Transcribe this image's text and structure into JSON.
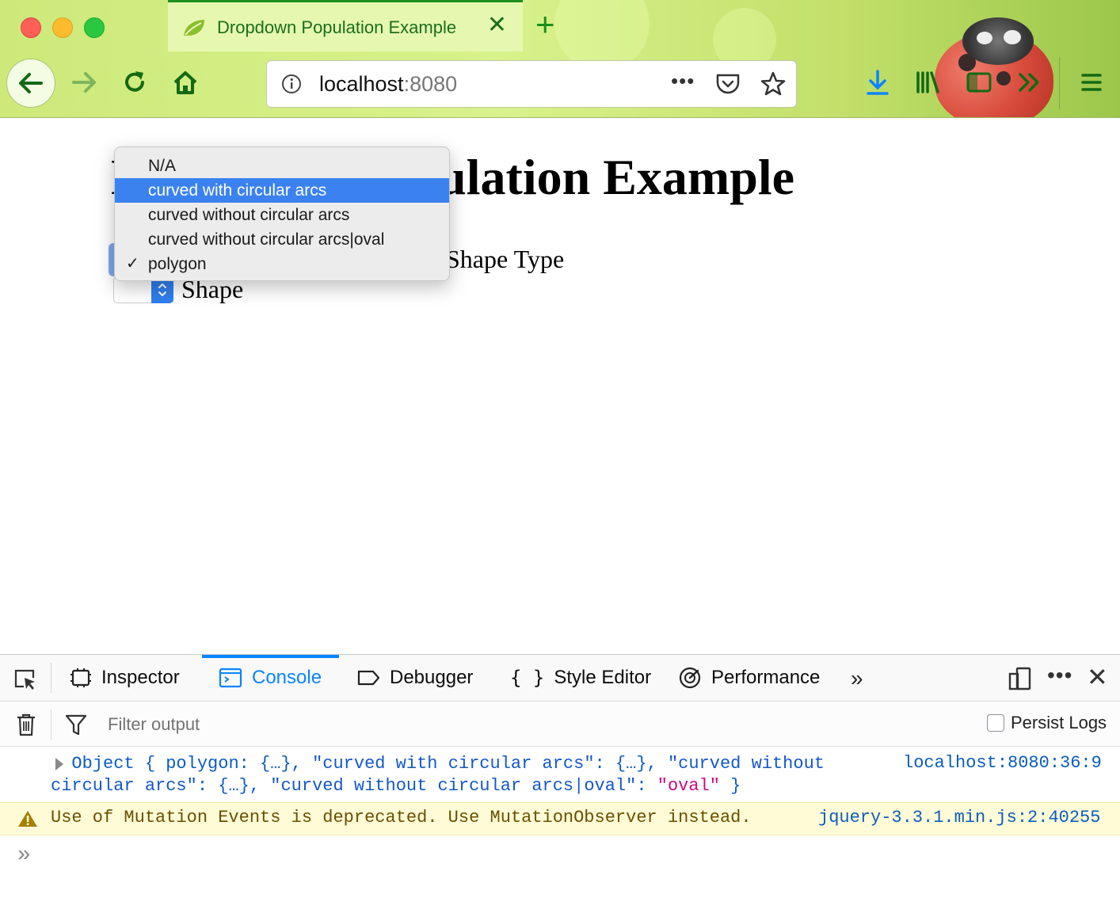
{
  "browser": {
    "tab_title": "Dropdown Population Example",
    "tab_close": "✕",
    "new_tab": "+",
    "url_host": "localhost",
    "url_port": ":8080",
    "url_more": "•••",
    "accent_color": "#1a8f1a"
  },
  "page": {
    "title": "Dropdown Population Example",
    "shape_type_label": "Shape Type",
    "shape_label": "Shape",
    "dropdown_options": [
      {
        "label": "N/A",
        "highlighted": false,
        "checked": false
      },
      {
        "label": "curved with circular arcs",
        "highlighted": true,
        "checked": false
      },
      {
        "label": "curved without circular arcs",
        "highlighted": false,
        "checked": false
      },
      {
        "label": "curved without circular arcs|oval",
        "highlighted": false,
        "checked": false
      },
      {
        "label": "polygon",
        "highlighted": false,
        "checked": true
      }
    ],
    "check_mark": "✓",
    "highlight_color": "#3b82f0"
  },
  "devtools": {
    "tabs": [
      {
        "label": "Inspector",
        "icon": "inspector-icon"
      },
      {
        "label": "Console",
        "icon": "console-icon",
        "active": true
      },
      {
        "label": "Debugger",
        "icon": "debugger-icon"
      },
      {
        "label": "Style Editor",
        "icon": "style-editor-icon"
      },
      {
        "label": "Performance",
        "icon": "performance-icon"
      }
    ],
    "more_tabs": "»",
    "more": "•••",
    "close": "✕",
    "filter_placeholder": "Filter output",
    "persist_logs_label": "Persist Logs",
    "persist_logs_checked": false,
    "log": {
      "prefix": "Object { polygon: {…}, ",
      "k1": "\"curved with circular arcs\"",
      "mid1": ": {…}, ",
      "k2a": "\"curved without",
      "k2b": "circular arcs\"",
      "mid2": ": {…}, ",
      "k3": "\"curved without circular arcs|oval\"",
      "mid3": ": ",
      "v3": "\"oval\"",
      "suffix": " }",
      "source": "localhost:8080:36:9"
    },
    "warning": {
      "text": "Use of Mutation Events is deprecated. Use MutationObserver instead.",
      "source": "jquery-3.3.1.min.js:2:40255"
    },
    "prompt": "»"
  }
}
